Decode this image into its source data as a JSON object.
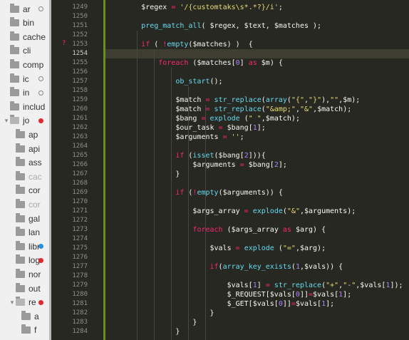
{
  "sidebar": {
    "items": [
      {
        "label": "ar",
        "icon": "folder-icon",
        "indent": 0,
        "badge": "ring"
      },
      {
        "label": "bin",
        "icon": "folder-icon",
        "indent": 0
      },
      {
        "label": "cache",
        "icon": "folder-icon",
        "indent": 0
      },
      {
        "label": "cli",
        "icon": "folder-icon",
        "indent": 0
      },
      {
        "label": "comp",
        "icon": "folder-icon",
        "indent": 0
      },
      {
        "label": "ic",
        "icon": "folder-icon",
        "indent": 0,
        "badge": "ring"
      },
      {
        "label": "in",
        "icon": "folder-icon",
        "indent": 0,
        "badge": "ring"
      },
      {
        "label": "includ",
        "icon": "folder-icon",
        "indent": 0
      },
      {
        "label": "jo",
        "icon": "folder-open-icon",
        "indent": 0,
        "badge": "red"
      },
      {
        "label": "ap",
        "icon": "folder-icon",
        "indent": 1
      },
      {
        "label": "api",
        "icon": "folder-icon",
        "indent": 1
      },
      {
        "label": "ass",
        "icon": "folder-icon",
        "indent": 1
      },
      {
        "label": "cac",
        "icon": "folder-icon",
        "indent": 1,
        "dim": true
      },
      {
        "label": "cor",
        "icon": "folder-icon",
        "indent": 1
      },
      {
        "label": "cor",
        "icon": "folder-icon",
        "indent": 1,
        "dim": true
      },
      {
        "label": "gal",
        "icon": "folder-icon",
        "indent": 1
      },
      {
        "label": "lan",
        "icon": "folder-icon",
        "indent": 1
      },
      {
        "label": "libr",
        "icon": "folder-icon",
        "indent": 1,
        "badge": "blue"
      },
      {
        "label": "log",
        "icon": "folder-icon",
        "indent": 1,
        "badge": "red"
      },
      {
        "label": "nor",
        "icon": "folder-icon",
        "indent": 1
      },
      {
        "label": "out",
        "icon": "folder-icon",
        "indent": 1
      },
      {
        "label": "re",
        "icon": "folder-open-icon",
        "indent": 1,
        "badge": "red"
      },
      {
        "label": "a",
        "icon": "folder-icon",
        "indent": 2
      },
      {
        "label": "f",
        "icon": "folder-icon",
        "indent": 2
      }
    ]
  },
  "gutter": {
    "lines": [
      "1249",
      "1250",
      "1251",
      "1252",
      "1253",
      "1254",
      "1255",
      "1256",
      "1257",
      "1258",
      "1259",
      "1260",
      "1261",
      "1262",
      "1263",
      "1264",
      "1265",
      "1266",
      "1267",
      "1268",
      "1269",
      "1270",
      "1271",
      "1272",
      "1273",
      "1274",
      "1275",
      "1276",
      "1277",
      "1278",
      "1279",
      "1280",
      "1281",
      "1282",
      "1283",
      "1284"
    ],
    "current_line": "1254",
    "marker_line": "1253",
    "marker_symbol": "?"
  },
  "code": {
    "lines": [
      "        $regex = '/{customtaks\\s*.*?}/i';",
      "",
      "        preg_match_all( $regex, $text, $matches );",
      "",
      "        if ( !empty($matches) )  {",
      "",
      "            foreach ($matches[0] as $m) {",
      "",
      "                ob_start();",
      "",
      "                $match = str_replace(array(\"{\",\"}\"),\"\",$m);",
      "                $match = str_replace(\"&amp;\",\"&\",$match);",
      "                $bang = explode (\" \",$match);",
      "                $our_task = $bang[1];",
      "                $arguments = '';",
      "",
      "                if (isset($bang[2])){",
      "                    $arguments = $bang[2];",
      "                }",
      "",
      "                if (!empty($arguments)) {",
      "",
      "                    $args_array = explode(\"&\",$arguments);",
      "",
      "                    foreach ($args_array as $arg) {",
      "",
      "                        $vals = explode (\"=\",$arg);",
      "",
      "                        if(array_key_exists(1,$vals)) {",
      "",
      "                            $vals[1] = str_replace(\"+\",\"-\",$vals[1]);",
      "                            $_REQUEST[$vals[0]]=$vals[1];",
      "                            $_GET[$vals[0]]=$vals[1];",
      "                        }",
      "                    }",
      "                }"
    ]
  }
}
